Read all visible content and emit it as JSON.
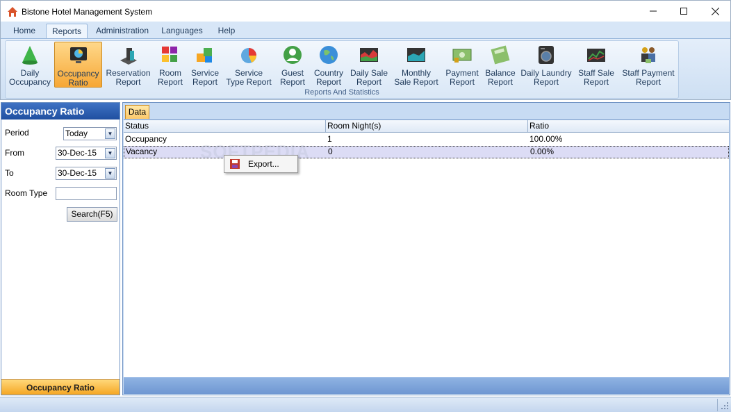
{
  "window": {
    "title": "Bistone Hotel Management System"
  },
  "menu": {
    "tabs": [
      "Home",
      "Reports",
      "Administration",
      "Languages",
      "Help"
    ],
    "active": "Reports"
  },
  "ribbon": {
    "group_label": "Reports And Statistics",
    "buttons": [
      {
        "line1": "Daily",
        "line2": "Occupancy",
        "icon": "cone-icon"
      },
      {
        "line1": "Occupancy",
        "line2": "Ratio",
        "icon": "monitor-chart-icon",
        "active": true
      },
      {
        "line1": "Reservation",
        "line2": "Report",
        "icon": "chart-3d-icon"
      },
      {
        "line1": "Room",
        "line2": "Report",
        "icon": "blocks-icon"
      },
      {
        "line1": "Service",
        "line2": "Report",
        "icon": "cubes-icon"
      },
      {
        "line1": "Service",
        "line2": "Type Report",
        "icon": "pie-icon"
      },
      {
        "line1": "Guest",
        "line2": "Report",
        "icon": "person-icon"
      },
      {
        "line1": "Country",
        "line2": "Report",
        "icon": "globe-icon"
      },
      {
        "line1": "Daily Sale",
        "line2": "Report",
        "icon": "area-chart-icon"
      },
      {
        "line1": "Monthly",
        "line2": "Sale Report",
        "icon": "area-chart-teal-icon"
      },
      {
        "line1": "Payment",
        "line2": "Report",
        "icon": "money-icon"
      },
      {
        "line1": "Balance",
        "line2": "Report",
        "icon": "calculator-icon"
      },
      {
        "line1": "Daily Laundry",
        "line2": "Report",
        "icon": "laundry-icon"
      },
      {
        "line1": "Staff Sale",
        "line2": "Report",
        "icon": "line-chart-icon"
      },
      {
        "line1": "Staff Payment",
        "line2": "Report",
        "icon": "staff-icon"
      }
    ]
  },
  "left_panel": {
    "title": "Occupancy Ratio",
    "period_label": "Period",
    "period_value": "Today",
    "from_label": "From",
    "from_value": "30-Dec-15",
    "to_label": "To",
    "to_value": "30-Dec-15",
    "room_type_label": "Room Type",
    "room_type_value": "",
    "search_button": "Search(F5)",
    "footer": "Occupancy Ratio"
  },
  "right_panel": {
    "tab": "Data",
    "columns": [
      "Status",
      "Room Night(s)",
      "Ratio"
    ],
    "rows": [
      [
        "Occupancy",
        "1",
        "100.00%"
      ],
      [
        "Vacancy",
        "0",
        "0.00%"
      ]
    ],
    "selected_row": 1
  },
  "context_menu": {
    "items": [
      "Export..."
    ]
  },
  "watermark": "SOFTPEDIA",
  "colors": {
    "accent_orange": "#f5a623",
    "header_blue": "#1f4fa0"
  }
}
